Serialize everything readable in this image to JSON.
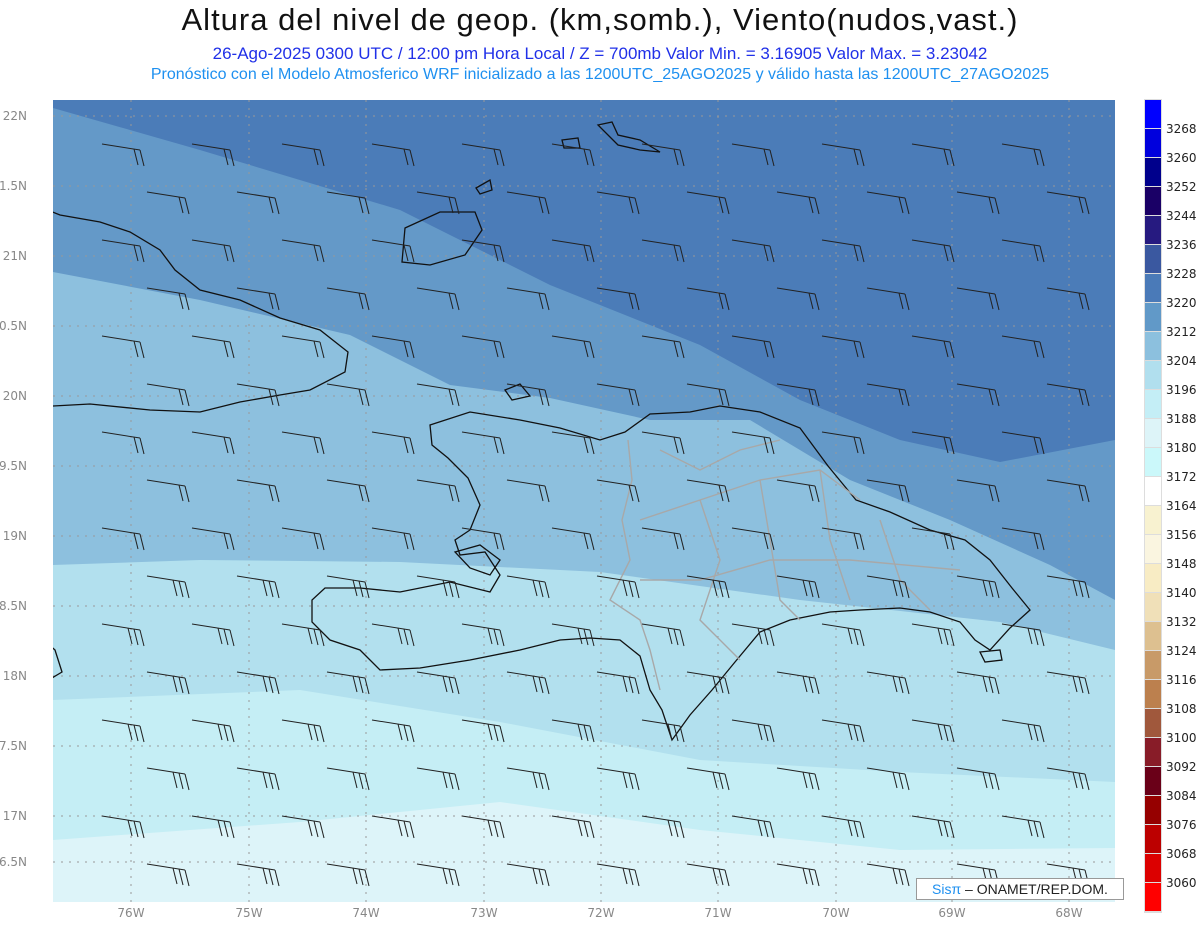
{
  "title": "Altura del nivel de geop. (km,somb.), Viento(nudos,vast.)",
  "subtitle_line1": "26-Ago-2025  0300 UTC / 12:00 pm Hora Local / Z = 700mb    Valor Min. = 3.16905   Valor Max. = 3.23042",
  "subtitle_line2": "Pronóstico con el Modelo Atmosferico WRF inicializado a las 1200UTC_25AGO2025 y válido hasta las  1200UTC_27AGO2025",
  "lat_labels": [
    "22N",
    "1.5N",
    "21N",
    "0.5N",
    "20N",
    "9.5N",
    "19N",
    "8.5N",
    "18N",
    "7.5N",
    "17N",
    "6.5N"
  ],
  "lon_labels": [
    "76W",
    "75W",
    "74W",
    "73W",
    "72W",
    "71W",
    "70W",
    "69W",
    "68W"
  ],
  "colorbar": {
    "levels": [
      "3268",
      "3260",
      "3252",
      "3244",
      "3236",
      "3228",
      "3220",
      "3212",
      "3204",
      "3196",
      "3188",
      "3180",
      "3172",
      "3164",
      "3156",
      "3148",
      "3140",
      "3132",
      "3124",
      "3116",
      "3108",
      "3100",
      "3092",
      "3084",
      "3076",
      "3068",
      "3060"
    ],
    "colors": [
      "#0000ff",
      "#0000dd",
      "#00008c",
      "#1a0066",
      "#261a80",
      "#3a58a0",
      "#4a7ab8",
      "#6199c8",
      "#8cc0de",
      "#b1dfee",
      "#c4eef6",
      "#ddf4f8",
      "#cbf8fa",
      "#ffffff",
      "#f8f2d0",
      "#faf5e0",
      "#f8ecc4",
      "#f0e0b8",
      "#ddc090",
      "#c89a68",
      "#bc804e",
      "#a0583c",
      "#881c28",
      "#6a0018",
      "#960000",
      "#bc0000",
      "#dc0000",
      "#ff0000"
    ]
  },
  "band_colors": [
    "#4b7cb8",
    "#6499c8",
    "#8dc0de",
    "#b2e0ee",
    "#c5eef5",
    "#ddf4f9"
  ],
  "credit": {
    "brand": "Sisπ",
    "text": " – ONAMET/REP.DOM."
  }
}
